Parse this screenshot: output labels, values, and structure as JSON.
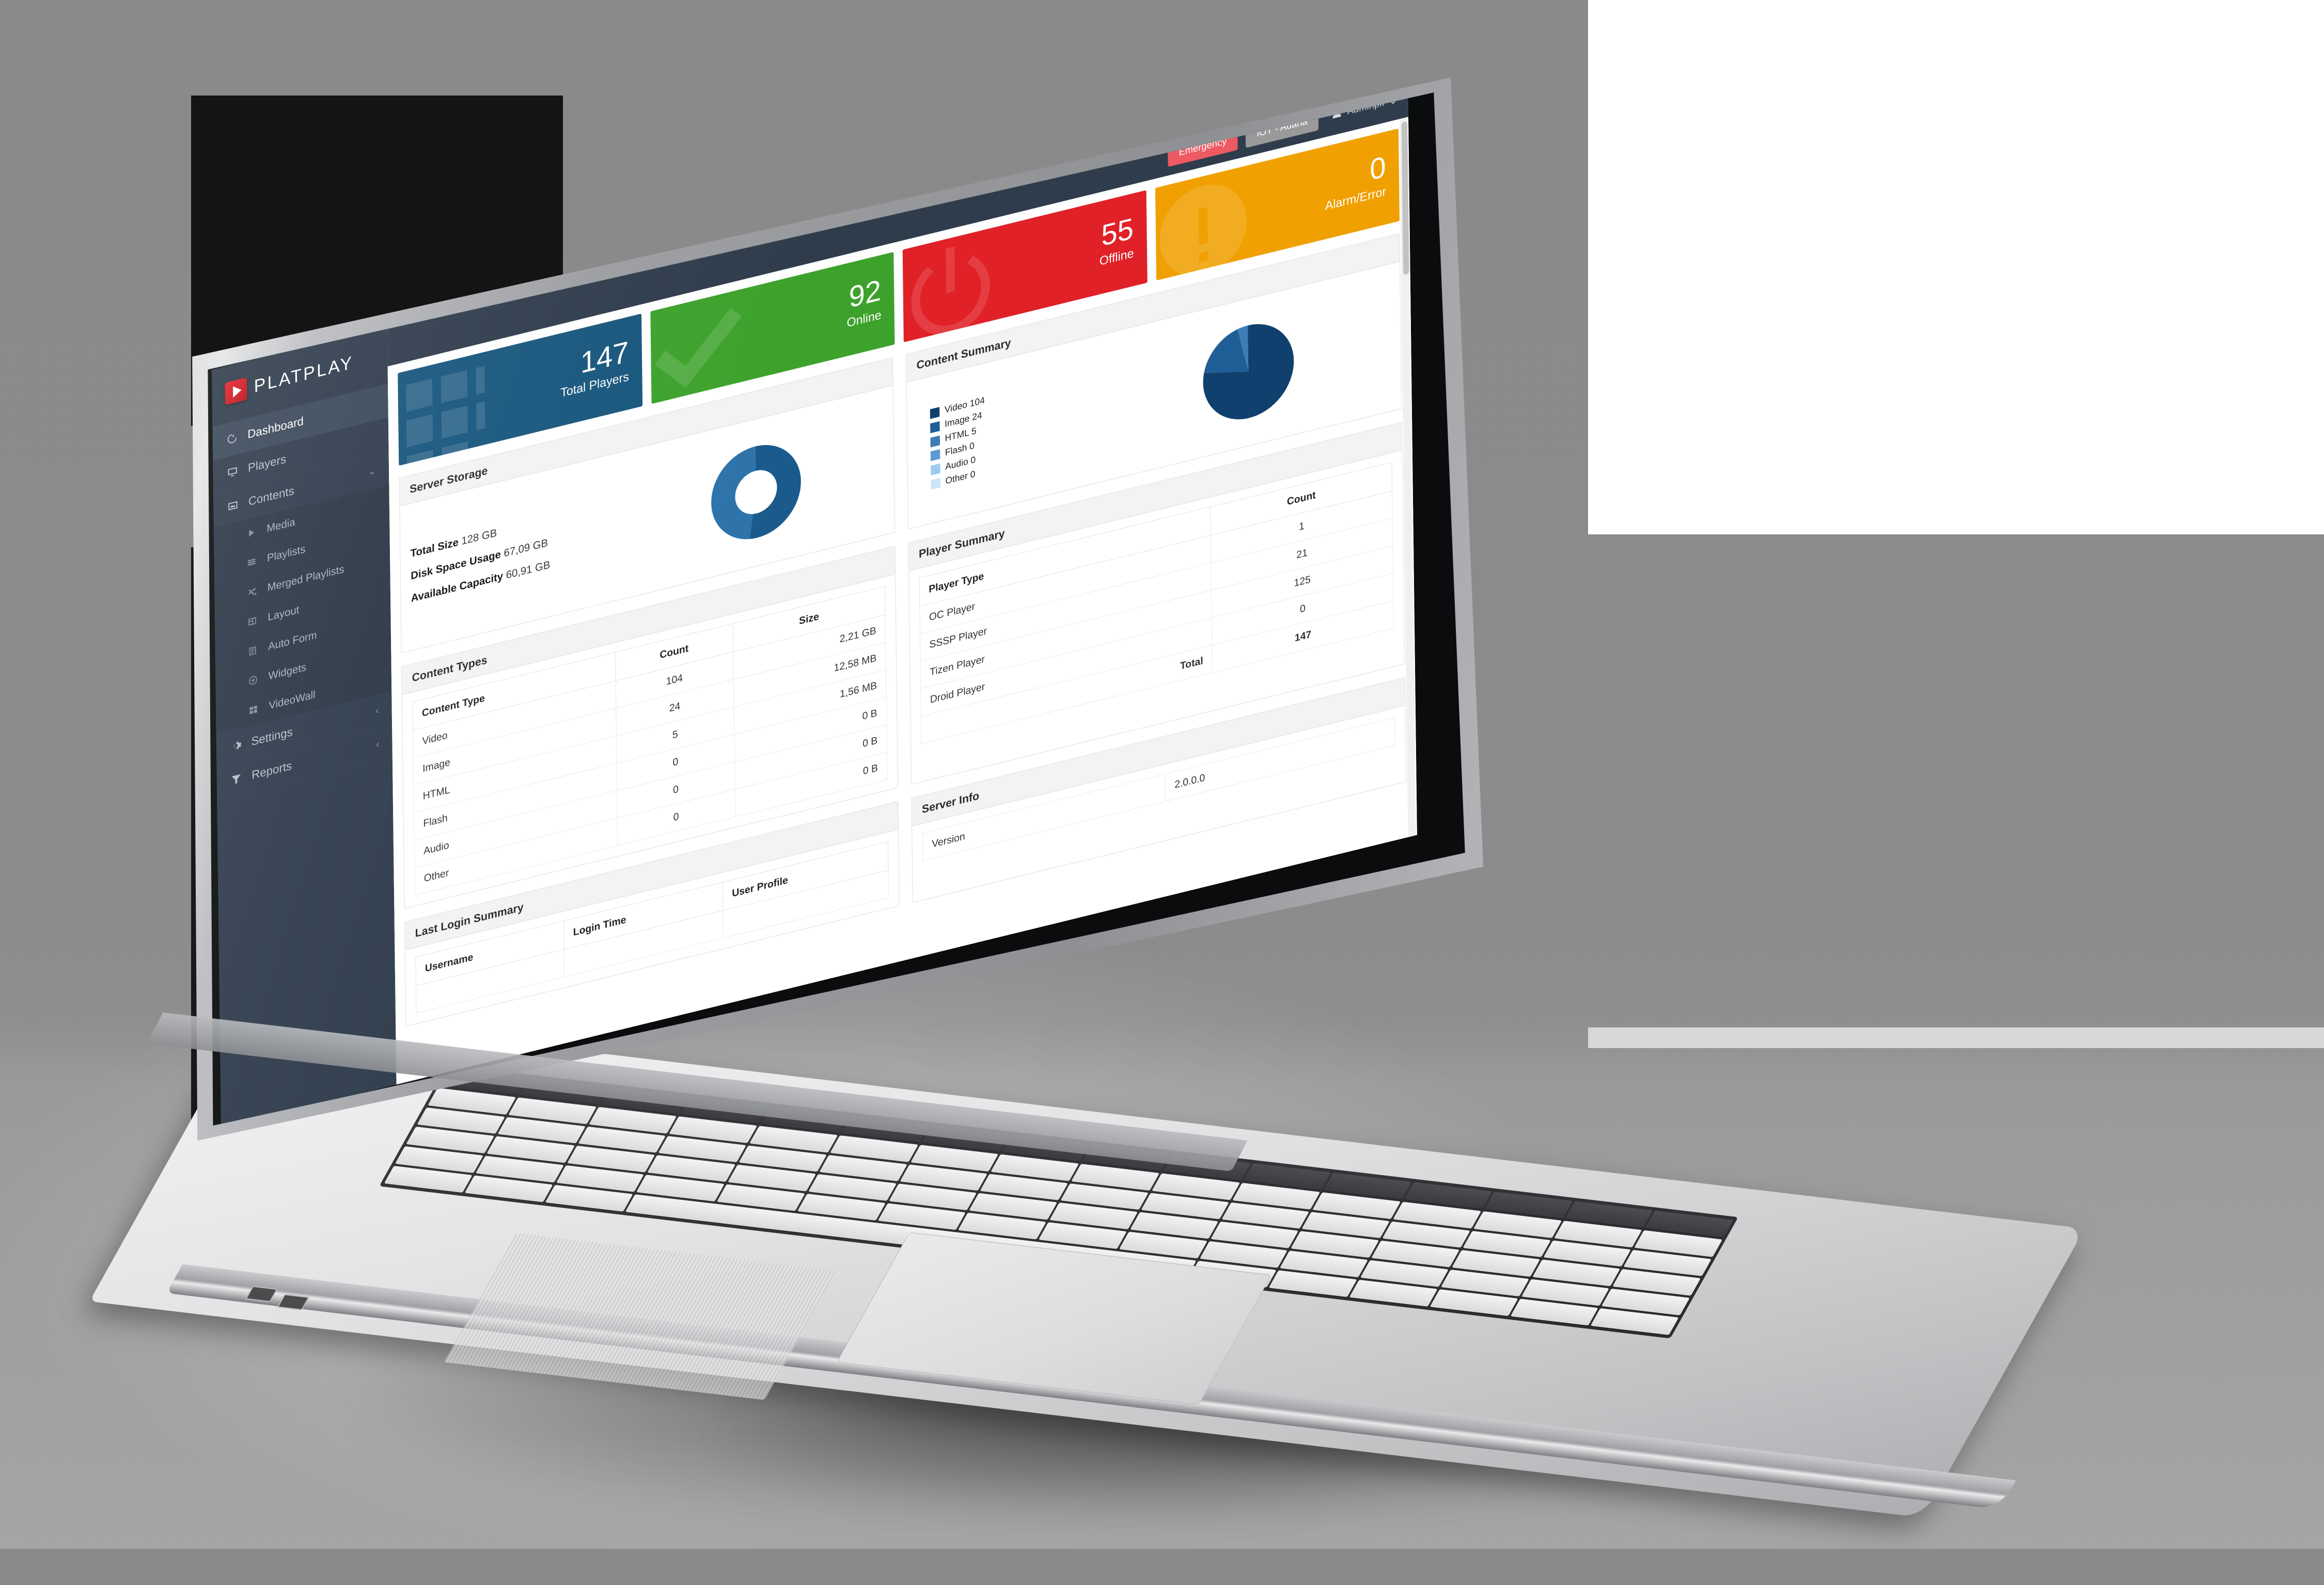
{
  "brand": {
    "name": "PLATPLAY"
  },
  "sidebar": {
    "items": [
      {
        "label": "Dashboard",
        "icon": "gauge-icon",
        "active": true
      },
      {
        "label": "Players",
        "icon": "monitor-icon",
        "active": false
      },
      {
        "label": "Contents",
        "icon": "image-icon",
        "active": false,
        "expanded": true,
        "caret": "⌄"
      }
    ],
    "contents_children": [
      {
        "label": "Media",
        "icon": "play-icon"
      },
      {
        "label": "Playlists",
        "icon": "list-icon"
      },
      {
        "label": "Merged Playlists",
        "icon": "shuffle-icon"
      },
      {
        "label": "Layout",
        "icon": "layout-icon"
      },
      {
        "label": "Auto Form",
        "icon": "form-icon"
      },
      {
        "label": "Widgets",
        "icon": "widget-icon"
      },
      {
        "label": "VideoWall",
        "icon": "videowall-icon"
      }
    ],
    "footer_items": [
      {
        "label": "Settings",
        "icon": "gear-icon",
        "caret": "‹"
      },
      {
        "label": "Reports",
        "icon": "funnel-icon",
        "caret": "‹"
      }
    ]
  },
  "topbar": {
    "emergency_label": "Emergency",
    "iot_label": "IOT - Adana",
    "user_label": "Adminpk",
    "user_caret": "⌄"
  },
  "kpis": [
    {
      "value": "147",
      "label": "Total Players",
      "color": "#18567d",
      "icon": "grid-icon"
    },
    {
      "value": "92",
      "label": "Online",
      "color": "#3da22c",
      "icon": "check-icon"
    },
    {
      "value": "55",
      "label": "Offline",
      "color": "#e02128",
      "icon": "power-icon"
    },
    {
      "value": "0",
      "label": "Alarm/Error",
      "color": "#f0a000",
      "icon": "warning-icon"
    }
  ],
  "server_storage": {
    "title": "Server Storage",
    "stats": [
      {
        "label": "Total Size",
        "value": "128 GB"
      },
      {
        "label": "Disk Space Usage",
        "value": "67,09 GB"
      },
      {
        "label": "Available Capacity",
        "value": "60,91 GB"
      }
    ]
  },
  "content_summary": {
    "title": "Content Summary",
    "legend": [
      {
        "label": "Video 104",
        "color": "#10406e"
      },
      {
        "label": "Image 24",
        "color": "#1f5e96"
      },
      {
        "label": "HTML 5",
        "color": "#3d7cb5"
      },
      {
        "label": "Flash 0",
        "color": "#5a9bd4"
      },
      {
        "label": "Audio 0",
        "color": "#9ecbef"
      },
      {
        "label": "Other 0",
        "color": "#c9e5fa"
      }
    ]
  },
  "content_types": {
    "title": "Content Types",
    "columns": [
      "Content Type",
      "Count",
      "Size"
    ],
    "rows": [
      {
        "type": "Video",
        "count": "104",
        "size": "2,21 GB"
      },
      {
        "type": "Image",
        "count": "24",
        "size": "12,58 MB"
      },
      {
        "type": "HTML",
        "count": "5",
        "size": "1,56 MB"
      },
      {
        "type": "Flash",
        "count": "0",
        "size": "0 B"
      },
      {
        "type": "Audio",
        "count": "0",
        "size": "0 B"
      },
      {
        "type": "Other",
        "count": "0",
        "size": "0 B"
      }
    ]
  },
  "player_summary": {
    "title": "Player Summary",
    "columns": [
      "Player Type",
      "Count"
    ],
    "rows": [
      {
        "type": "OC Player",
        "count": "1"
      },
      {
        "type": "SSSP Player",
        "count": "21"
      },
      {
        "type": "Tizen Player",
        "count": "125"
      },
      {
        "type": "Droid Player",
        "count": "0"
      }
    ],
    "total_label": "Total",
    "total_value": "147"
  },
  "last_login": {
    "title": "Last Login Summary",
    "columns": [
      "Username",
      "Login Time",
      "User Profile"
    ]
  },
  "server_info": {
    "title": "Server Info",
    "rows": [
      {
        "label": "Version",
        "value": "2.0.0.0"
      }
    ]
  },
  "chart_data": [
    {
      "type": "pie",
      "title": "Server Storage",
      "labels": [
        "Disk Space Usage",
        "Available Capacity"
      ],
      "values": [
        67.09,
        60.91
      ],
      "unit": "GB",
      "colors": [
        "#1b5a8c",
        "#2e74ab"
      ],
      "donut": true,
      "legend": "none"
    },
    {
      "type": "pie",
      "title": "Content Summary",
      "labels": [
        "Video",
        "Image",
        "HTML",
        "Flash",
        "Audio",
        "Other"
      ],
      "values": [
        104,
        24,
        5,
        0,
        0,
        0
      ],
      "colors": [
        "#10406e",
        "#1f5e96",
        "#3d7cb5",
        "#5a9bd4",
        "#9ecbef",
        "#c9e5fa"
      ],
      "donut": false,
      "legend": "left"
    },
    {
      "type": "table",
      "title": "Content Types",
      "columns": [
        "Content Type",
        "Count",
        "Size"
      ],
      "rows": [
        [
          "Video",
          104,
          "2,21 GB"
        ],
        [
          "Image",
          24,
          "12,58 MB"
        ],
        [
          "HTML",
          5,
          "1,56 MB"
        ],
        [
          "Flash",
          0,
          "0 B"
        ],
        [
          "Audio",
          0,
          "0 B"
        ],
        [
          "Other",
          0,
          "0 B"
        ]
      ]
    },
    {
      "type": "table",
      "title": "Player Summary",
      "columns": [
        "Player Type",
        "Count"
      ],
      "rows": [
        [
          "OC Player",
          1
        ],
        [
          "SSSP Player",
          21
        ],
        [
          "Tizen Player",
          125
        ],
        [
          "Droid Player",
          0
        ],
        [
          "Total",
          147
        ]
      ]
    }
  ]
}
